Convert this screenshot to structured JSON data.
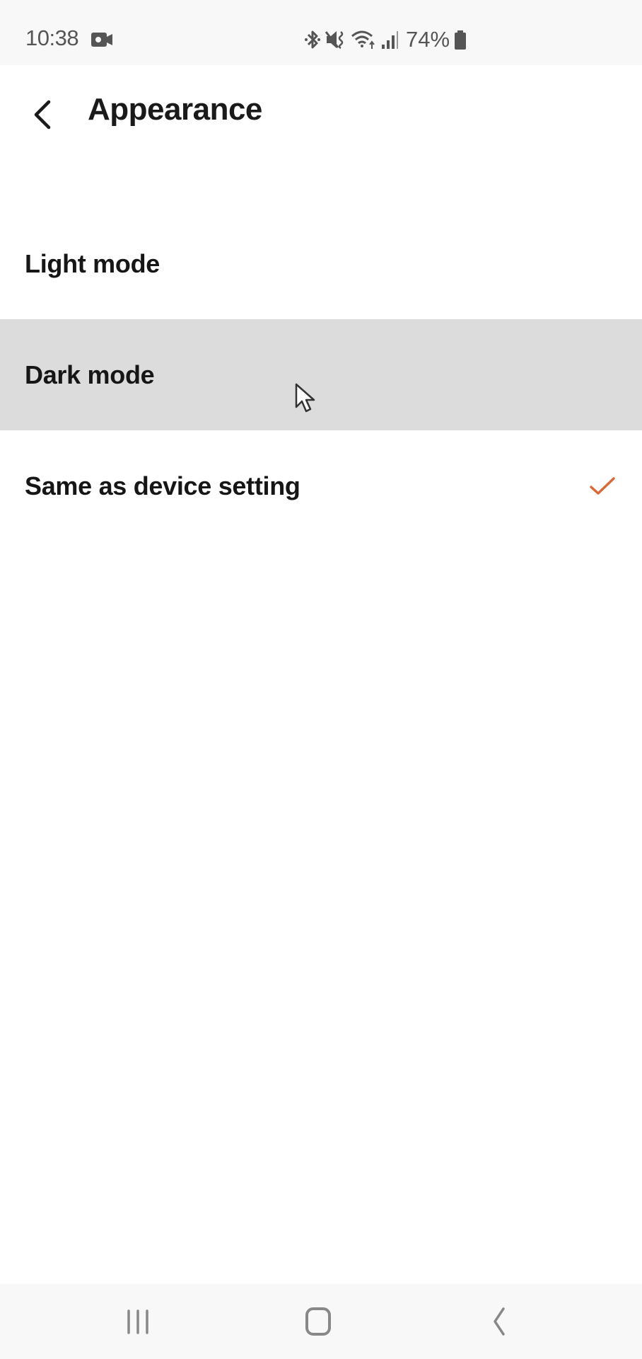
{
  "status_bar": {
    "time": "10:38",
    "battery_percent": "74%",
    "icons": [
      "video-record-icon",
      "bluetooth-icon",
      "mute-vibrate-icon",
      "wifi-icon",
      "signal-icon",
      "battery-icon"
    ]
  },
  "header": {
    "back_icon": "chevron-left-icon",
    "title": "Appearance"
  },
  "options": [
    {
      "label": "Light mode",
      "selected": false,
      "highlighted": false
    },
    {
      "label": "Dark mode",
      "selected": false,
      "highlighted": true
    },
    {
      "label": "Same as device setting",
      "selected": true,
      "highlighted": false
    }
  ],
  "colors": {
    "accent_check": "#D86A3A",
    "highlight_row": "#DCDCDC",
    "bars_bg": "#F8F8F8",
    "text_primary": "#161616"
  },
  "nav_bar": {
    "buttons": [
      "recent-apps",
      "home",
      "back"
    ]
  }
}
